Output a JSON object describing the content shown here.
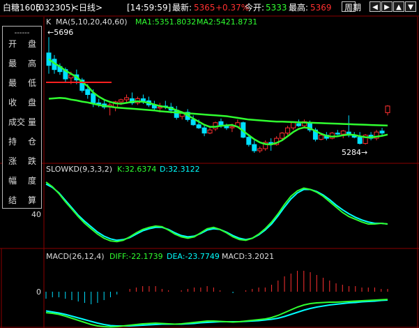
{
  "header": {
    "symbol": "白糖1605",
    "code": "(032305)",
    "period": "<日线>",
    "time": "[14:59:59]",
    "latest_label": "最新:",
    "latest_value": "5365",
    "change_pct": "+0.37%",
    "open_label": "今开:",
    "open_value": "5333",
    "high_label": "最高:",
    "high_value": "5369",
    "period_button": "周期"
  },
  "main_panel": {
    "k_label": "K",
    "ma_label": "MA(5,10,20,40,60)",
    "ma1": "MA1:5351.8032",
    "ma2": "MA2:5421.8731",
    "high_annotation": "←5696",
    "low_annotation": "5284→"
  },
  "kd_panel": {
    "label": "SLOWKD(9,3,3,2)",
    "k_value": "K:32.6374",
    "d_value": "D:32.3122",
    "axis_tick": "40"
  },
  "macd_panel": {
    "label": "MACD(26,12,4)",
    "diff": "DIFF:-22.1739",
    "dea": "DEA:-23.7749",
    "macd": "MACD:3.2021",
    "axis_tick": "0"
  },
  "info_box": {
    "divider": "------",
    "rows": [
      [
        "开",
        "盘"
      ],
      [
        "最",
        "高"
      ],
      [
        "最",
        "低"
      ],
      [
        "收",
        "盘"
      ],
      [
        "成交",
        "量"
      ],
      [
        "持",
        "仓"
      ],
      [
        "涨",
        "跌"
      ],
      [
        "幅",
        "度"
      ],
      [
        "结",
        "算"
      ]
    ]
  },
  "colors": {
    "up": "#ff3030",
    "down": "#00e0ff",
    "ma1": "#ffffff",
    "ma_green": "#30ff30",
    "ma_red": "#ff2020",
    "k_line": "#ff20ff",
    "d_line": "#00ffff",
    "grid": "#8b0000"
  },
  "chart_data": {
    "type": "candlestick",
    "candles": [
      [
        5620,
        5696,
        5520,
        5560
      ],
      [
        5590,
        5610,
        5520,
        5540
      ],
      [
        5555,
        5570,
        5515,
        5530
      ],
      [
        5540,
        5550,
        5480,
        5495
      ],
      [
        5500,
        5530,
        5470,
        5515
      ],
      [
        5515,
        5540,
        5470,
        5490
      ],
      [
        5490,
        5500,
        5430,
        5440
      ],
      [
        5445,
        5470,
        5400,
        5420
      ],
      [
        5425,
        5445,
        5360,
        5380
      ],
      [
        5380,
        5400,
        5360,
        5375
      ],
      [
        5375,
        5395,
        5350,
        5360
      ],
      [
        5360,
        5380,
        5320,
        5370
      ],
      [
        5360,
        5390,
        5340,
        5385
      ],
      [
        5385,
        5400,
        5370,
        5395
      ],
      [
        5395,
        5420,
        5380,
        5405
      ],
      [
        5400,
        5430,
        5370,
        5380
      ],
      [
        5380,
        5410,
        5370,
        5400
      ],
      [
        5400,
        5420,
        5375,
        5390
      ],
      [
        5390,
        5410,
        5360,
        5370
      ],
      [
        5370,
        5390,
        5340,
        5355
      ],
      [
        5355,
        5380,
        5335,
        5360
      ],
      [
        5365,
        5390,
        5350,
        5360
      ],
      [
        5360,
        5380,
        5330,
        5345
      ],
      [
        5345,
        5365,
        5300,
        5310
      ],
      [
        5315,
        5340,
        5300,
        5335
      ],
      [
        5335,
        5350,
        5290,
        5300
      ],
      [
        5300,
        5320,
        5270,
        5275
      ],
      [
        5275,
        5300,
        5255,
        5260
      ],
      [
        5260,
        5270,
        5220,
        5235
      ],
      [
        5235,
        5260,
        5230,
        5250
      ],
      [
        5255,
        5290,
        5245,
        5285
      ],
      [
        5290,
        5305,
        5260,
        5270
      ],
      [
        5270,
        5280,
        5250,
        5260
      ],
      [
        5260,
        5280,
        5240,
        5265
      ],
      [
        5265,
        5300,
        5260,
        5285
      ],
      [
        5285,
        5290,
        5210,
        5215
      ],
      [
        5215,
        5230,
        5170,
        5180
      ],
      [
        5180,
        5200,
        5140,
        5150
      ],
      [
        5150,
        5170,
        5140,
        5160
      ],
      [
        5160,
        5200,
        5150,
        5190
      ],
      [
        5190,
        5210,
        5150,
        5180
      ],
      [
        5180,
        5220,
        5175,
        5210
      ],
      [
        5210,
        5240,
        5200,
        5235
      ],
      [
        5235,
        5270,
        5225,
        5260
      ],
      [
        5260,
        5290,
        5250,
        5285
      ],
      [
        5280,
        5300,
        5265,
        5270
      ],
      [
        5270,
        5300,
        5260,
        5290
      ],
      [
        5285,
        5295,
        5240,
        5250
      ],
      [
        5250,
        5260,
        5195,
        5205
      ],
      [
        5205,
        5230,
        5200,
        5225
      ],
      [
        5225,
        5240,
        5200,
        5210
      ],
      [
        5210,
        5240,
        5205,
        5235
      ],
      [
        5235,
        5250,
        5225,
        5230
      ],
      [
        5230,
        5250,
        5210,
        5245
      ],
      [
        5240,
        5320,
        5215,
        5225
      ],
      [
        5225,
        5240,
        5210,
        5215
      ],
      [
        5215,
        5240,
        5180,
        5185
      ],
      [
        5185,
        5230,
        5180,
        5225
      ],
      [
        5225,
        5240,
        5200,
        5210
      ],
      [
        5210,
        5250,
        5200,
        5240
      ],
      [
        5245,
        5260,
        5225,
        5235
      ],
      [
        5333,
        5369,
        5320,
        5365
      ]
    ],
    "ma_slow": [
      5400,
      5402,
      5404,
      5402,
      5396,
      5392,
      5386,
      5382,
      5376,
      5370,
      5365,
      5362,
      5358,
      5356,
      5354,
      5352,
      5350,
      5348,
      5346,
      5344,
      5340,
      5338,
      5336,
      5334,
      5332,
      5330,
      5328,
      5326,
      5324,
      5322,
      5320,
      5318,
      5316,
      5312,
      5308,
      5304,
      5300,
      5298,
      5296,
      5294,
      5292,
      5290,
      5290,
      5289,
      5288,
      5287,
      5286,
      5285,
      5284,
      5283,
      5282,
      5281,
      5280,
      5279,
      5278,
      5277,
      5276,
      5275,
      5274,
      5273,
      5272,
      5271
    ],
    "ma_fast": [
      5590,
      5570,
      5555,
      5535,
      5520,
      5505,
      5480,
      5460,
      5430,
      5410,
      5395,
      5385,
      5378,
      5376,
      5380,
      5385,
      5388,
      5385,
      5380,
      5372,
      5365,
      5360,
      5355,
      5345,
      5335,
      5320,
      5305,
      5290,
      5275,
      5265,
      5265,
      5270,
      5272,
      5274,
      5265,
      5245,
      5225,
      5205,
      5190,
      5182,
      5180,
      5188,
      5200,
      5220,
      5240,
      5255,
      5262,
      5258,
      5245,
      5232,
      5222,
      5218,
      5220,
      5225,
      5228,
      5226,
      5220,
      5215,
      5214,
      5218,
      5222,
      5228
    ],
    "kd_k": [
      95,
      88,
      78,
      66,
      55,
      44,
      34,
      26,
      18,
      12,
      8,
      7,
      9,
      14,
      20,
      25,
      28,
      30,
      29,
      24,
      18,
      14,
      12,
      14,
      20,
      26,
      28,
      25,
      20,
      14,
      10,
      9,
      12,
      18,
      26,
      36,
      48,
      62,
      74,
      82,
      86,
      84,
      80,
      74,
      66,
      58,
      50,
      44,
      40,
      36,
      33,
      33,
      34,
      33
    ],
    "kd_d": [
      92,
      87,
      79,
      68,
      57,
      46,
      37,
      29,
      21,
      15,
      11,
      9,
      10,
      13,
      18,
      23,
      26,
      28,
      28,
      25,
      20,
      16,
      14,
      15,
      19,
      24,
      26,
      25,
      21,
      16,
      12,
      10,
      12,
      17,
      24,
      33,
      45,
      58,
      70,
      79,
      84,
      84,
      81,
      76,
      69,
      61,
      54,
      48,
      43,
      39,
      36,
      34,
      34,
      33
    ],
    "macd_diff": [
      -60,
      -62,
      -65,
      -70,
      -76,
      -82,
      -88,
      -94,
      -98,
      -100,
      -101,
      -100,
      -98,
      -96,
      -94,
      -92,
      -91,
      -90,
      -91,
      -92,
      -93,
      -92,
      -90,
      -88,
      -86,
      -84,
      -84,
      -85,
      -86,
      -87,
      -86,
      -84,
      -82,
      -80,
      -78,
      -74,
      -68,
      -60,
      -52,
      -44,
      -38,
      -34,
      -32,
      -31,
      -30,
      -30,
      -29,
      -28,
      -27,
      -26,
      -25,
      -24,
      -23,
      -22
    ],
    "macd_dea": [
      -55,
      -58,
      -61,
      -65,
      -70,
      -75,
      -80,
      -85,
      -90,
      -94,
      -97,
      -98,
      -98,
      -98,
      -97,
      -96,
      -95,
      -94,
      -93,
      -93,
      -93,
      -93,
      -92,
      -91,
      -89,
      -88,
      -87,
      -86,
      -86,
      -86,
      -86,
      -85,
      -84,
      -83,
      -81,
      -79,
      -76,
      -71,
      -65,
      -59,
      -53,
      -48,
      -44,
      -41,
      -38,
      -36,
      -34,
      -32,
      -31,
      -29,
      -28,
      -27,
      -25,
      -24
    ]
  }
}
